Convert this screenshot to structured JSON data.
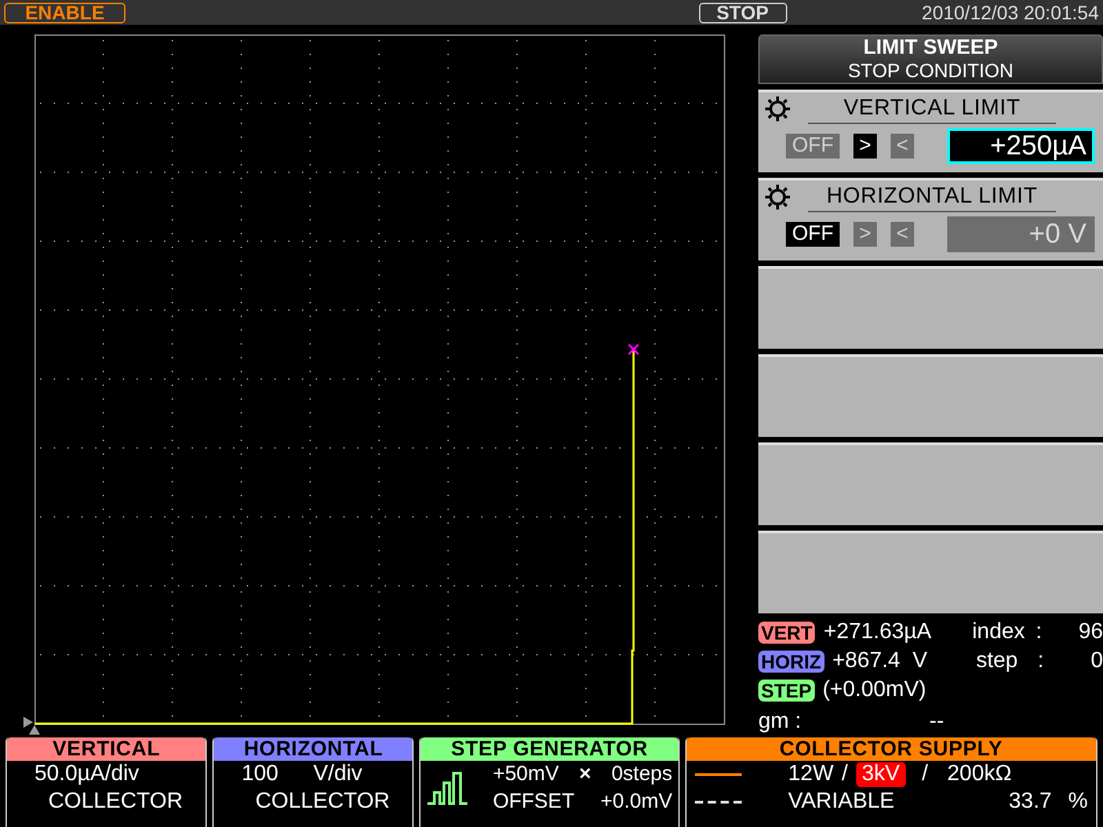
{
  "top_bar": {
    "enable_button": "ENABLE",
    "stop_button": "STOP",
    "datetime": "2010/12/03 20:01:54"
  },
  "limit_panel": {
    "title": "LIMIT SWEEP",
    "subtitle": "STOP CONDITION",
    "limits": [
      {
        "label": "VERTICAL LIMIT",
        "options": [
          {
            "label": "OFF",
            "selected": false
          },
          {
            "label": ">",
            "selected": true
          },
          {
            "label": "<",
            "selected": false
          }
        ],
        "value": "+250µA",
        "active": true
      },
      {
        "label": "HORIZONTAL LIMIT",
        "options": [
          {
            "label": "OFF",
            "selected": true
          },
          {
            "label": ">",
            "selected": false
          },
          {
            "label": "<",
            "selected": false
          }
        ],
        "value": "+0 V",
        "active": false
      }
    ]
  },
  "readouts": [
    {
      "tag": "VERT",
      "color": "#ff8080",
      "value": "+271.63µA",
      "label": "index",
      "separator": ":",
      "reading": "96"
    },
    {
      "tag": "HORIZ",
      "color": "#8080ff",
      "value": "+867.4  V",
      "label": "step",
      "separator": ":",
      "reading": "0"
    },
    {
      "tag": "STEP",
      "color": "#80ff80",
      "value": "(+0.00mV)"
    }
  ],
  "gm": {
    "label": "gm :",
    "value": "--"
  },
  "bottom_panels": [
    {
      "kind": "scale",
      "title": "VERTICAL",
      "color": "#ff8080",
      "scale": "50.0µA/div",
      "source": "COLLECTOR"
    },
    {
      "kind": "scale",
      "title": "HORIZONTAL",
      "color": "#8080ff",
      "scale_value": "100",
      "scale_unit": "V/div",
      "source": "COLLECTOR"
    },
    {
      "kind": "step",
      "title": "STEP GENERATOR",
      "color": "#80ff80",
      "amplitude": "+50mV",
      "times": "×",
      "steps": "0steps",
      "offset_label": "OFFSET",
      "offset": "+0.0mV"
    },
    {
      "kind": "supply",
      "title": "COLLECTOR SUPPLY",
      "color": "#ff8000",
      "power": "12W",
      "sep1": "/",
      "voltage": "3kV",
      "sep2": "/",
      "resistance": "200kΩ",
      "mode": "VARIABLE",
      "percent": "33.7",
      "percent_unit": "%"
    }
  ]
}
